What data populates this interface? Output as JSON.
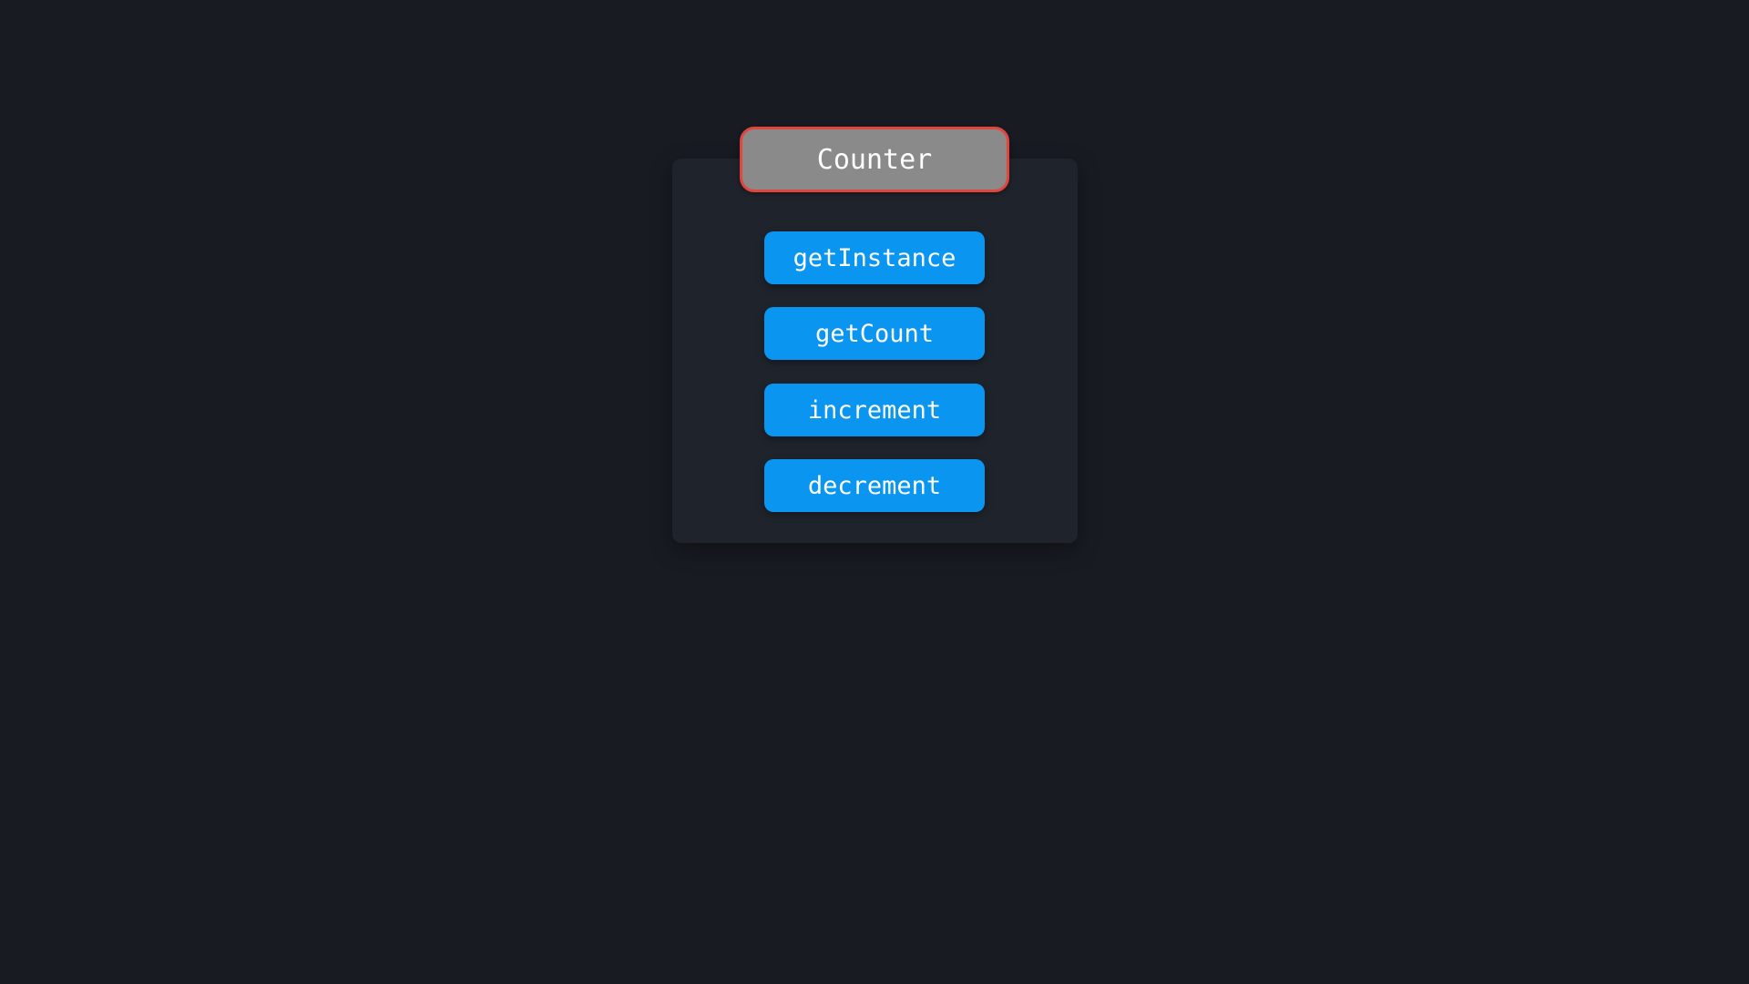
{
  "counter": {
    "title": "Counter",
    "methods": [
      "getInstance",
      "getCount",
      "increment",
      "decrement"
    ]
  },
  "colors": {
    "background": "#181b22",
    "panel": "#1f232b",
    "title_fill": "#8a8a8a",
    "title_border": "#e2453c",
    "method_button": "#0a95f0",
    "text": "#ffffff"
  }
}
